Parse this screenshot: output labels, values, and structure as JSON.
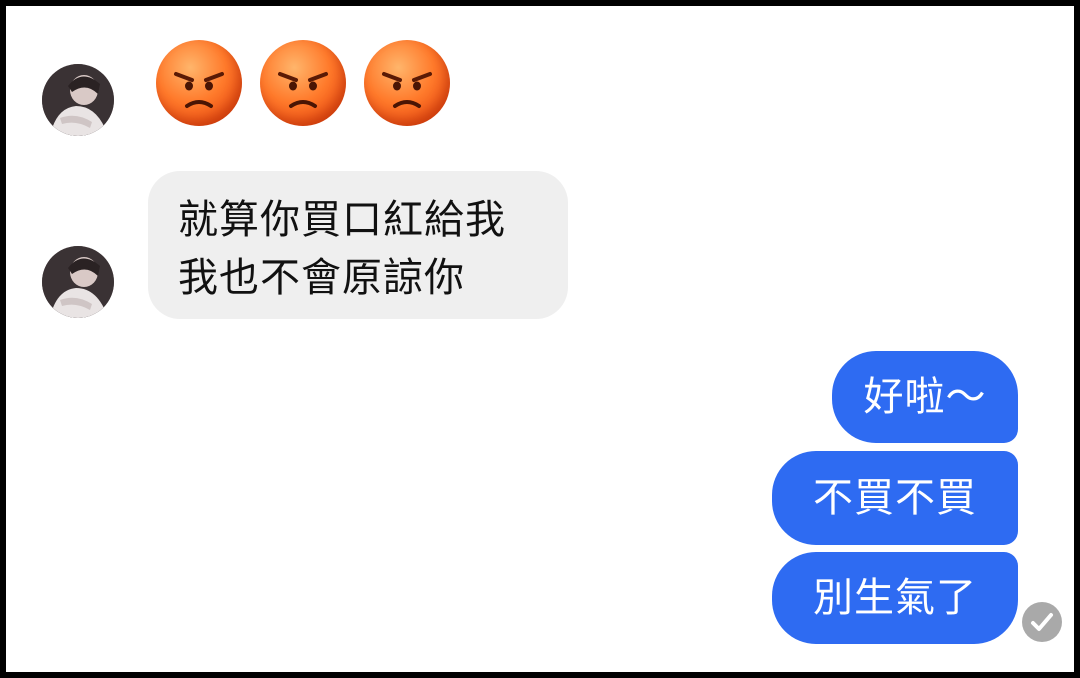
{
  "conversation": {
    "reactions": {
      "emojis": [
        "angry-face-emoji",
        "angry-face-emoji",
        "angry-face-emoji"
      ],
      "emoji_color": "#ff7a2b"
    },
    "received_message": {
      "lines": [
        "就算你買口紅給我",
        "我也不會原諒你"
      ],
      "bubble_color": "#efefef"
    },
    "sent_messages": [
      {
        "text": "好啦～"
      },
      {
        "text": "不買不買"
      },
      {
        "text": "別生氣了"
      }
    ],
    "sent_bubble_color": "#2e6bf2",
    "status_icon": "read-check-icon"
  }
}
